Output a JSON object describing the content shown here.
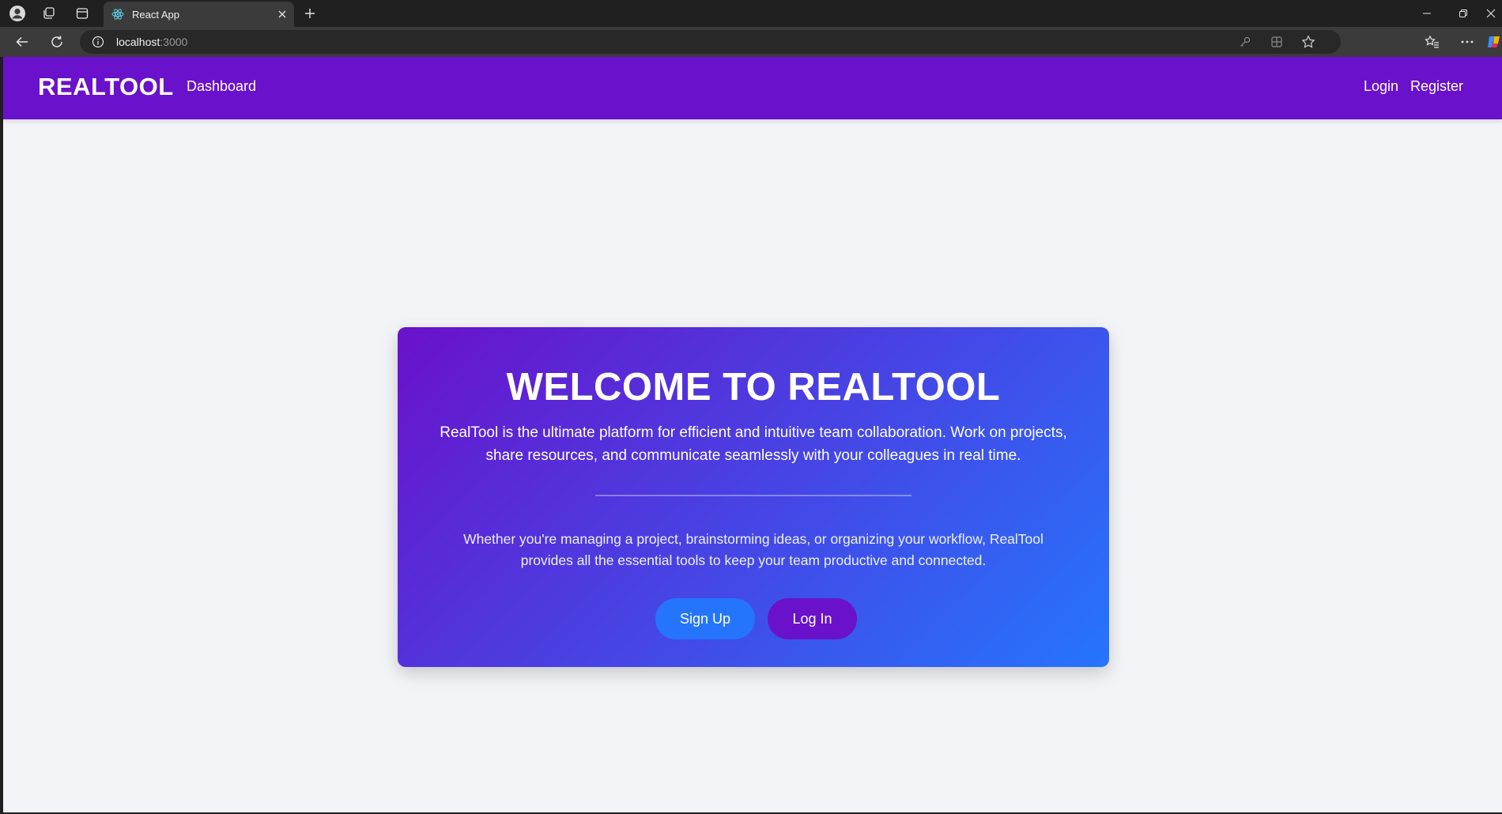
{
  "browser": {
    "tab": {
      "title": "React App"
    },
    "url": {
      "host": "localhost",
      "port": ":3000"
    }
  },
  "navbar": {
    "brand": "REALTOOL",
    "links": {
      "dashboard": "Dashboard",
      "login": "Login",
      "register": "Register"
    },
    "color": "#6a11cb"
  },
  "hero": {
    "title": "WELCOME TO REALTOOL",
    "lead": "RealTool is the ultimate platform for efficient and intuitive team collaboration. Work on projects, share resources, and communicate seamlessly with your colleagues in real time.",
    "subtext": "Whether you're managing a project, brainstorming ideas, or organizing your workflow, RealTool provides all the essential tools to keep your team productive and connected.",
    "buttons": {
      "signup": "Sign Up",
      "login": "Log In"
    },
    "gradient": {
      "from": "#6a11cb",
      "to": "#2575fc"
    }
  },
  "page": {
    "background": "#f2f4f8"
  }
}
